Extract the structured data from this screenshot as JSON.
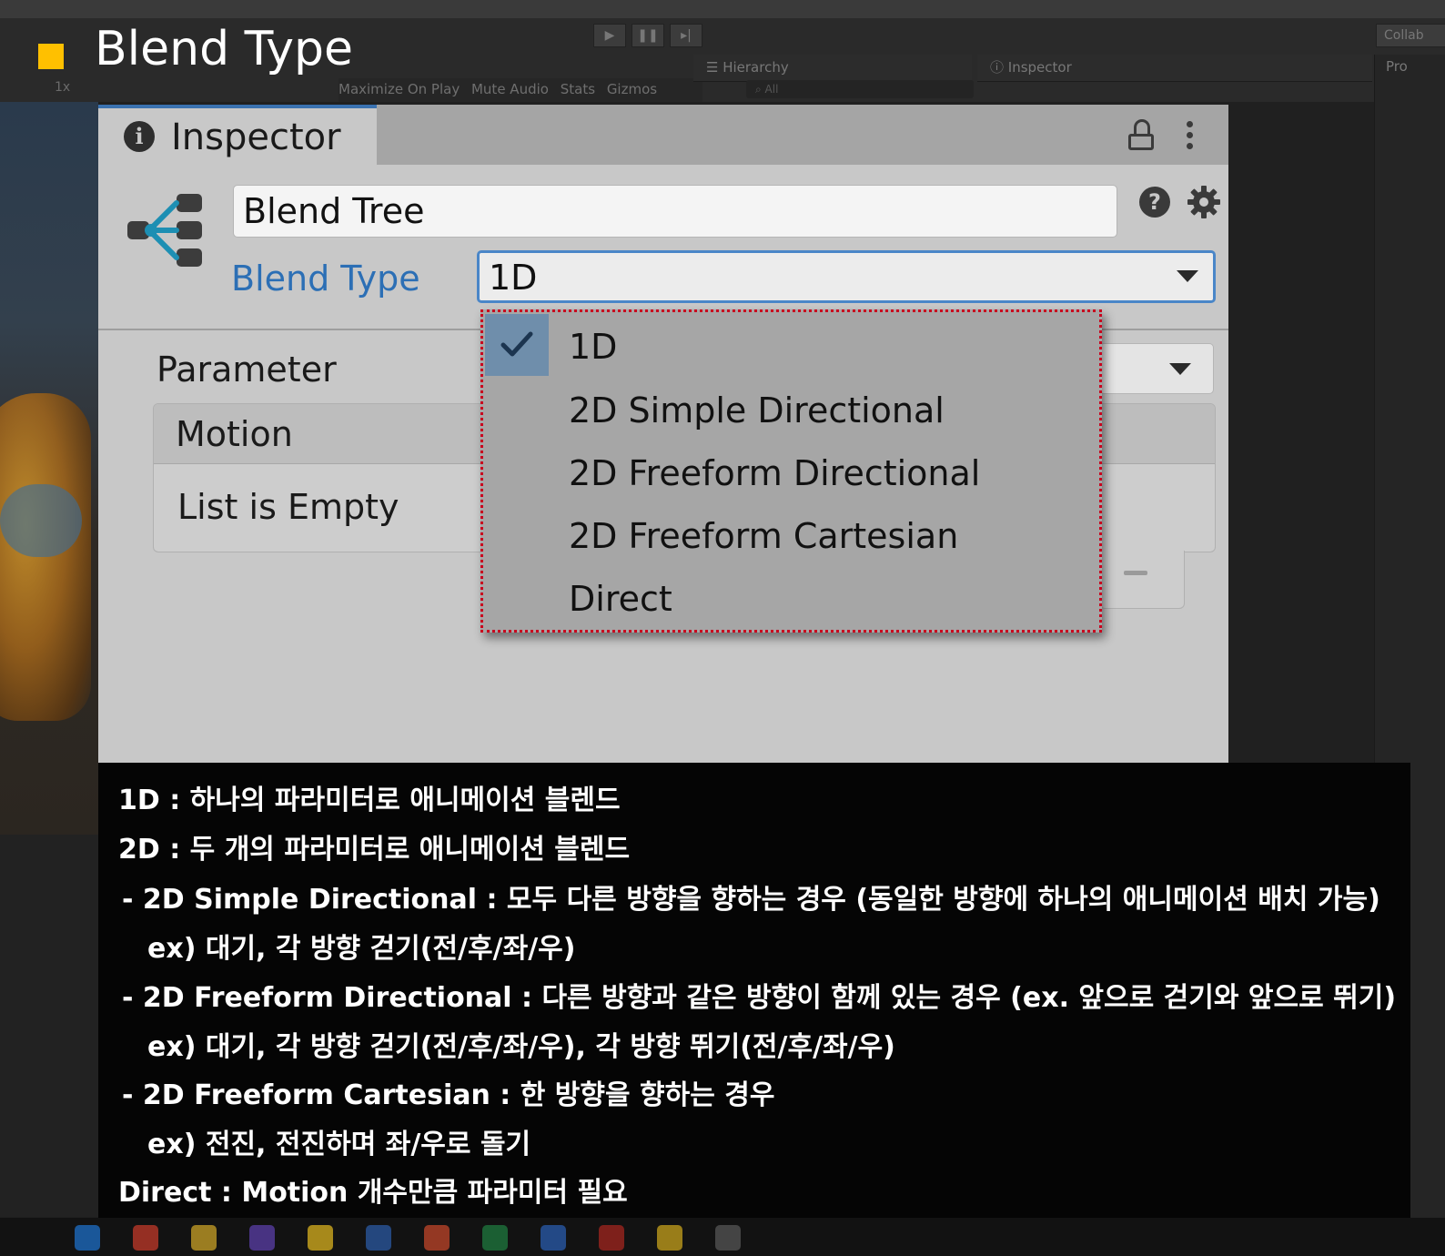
{
  "slide": {
    "title": "Blend Type",
    "accent": "#ffc000"
  },
  "editor_bg": {
    "scale_label": "1x",
    "game_toolbar": [
      "Maximize On Play",
      "Mute Audio",
      "Stats",
      "Gizmos"
    ],
    "hierarchy_tab": "Hierarchy",
    "hierarchy_search": "All",
    "inspector_tab_small": "Inspector",
    "collab_label": "Collab",
    "project_tab": "Pro"
  },
  "inspector": {
    "tab_label": "Inspector",
    "name_value": "Blend Tree",
    "blend_type_label": "Blend Type",
    "blend_type_value": "1D",
    "parameter_label": "Parameter",
    "motion_header": "Motion",
    "list_empty_text": "List is Empty",
    "accent": "#2c6fb5",
    "icons": [
      "info-icon",
      "lock-icon",
      "kebab-menu-icon",
      "blend-tree-icon",
      "help-icon",
      "gear-icon",
      "dropdown-caret-icon",
      "minus-icon"
    ]
  },
  "dropdown": {
    "selected": "1D",
    "options": [
      "1D",
      "2D Simple Directional",
      "2D Freeform Directional",
      "2D Freeform Cartesian",
      "Direct"
    ],
    "highlight_border": "#c8001e",
    "check_icon": "checkmark-icon"
  },
  "caption": {
    "lines": [
      "1D : 하나의 파라미터로 애니메이션 블렌드",
      "2D : 두 개의 파라미터로 애니메이션 블렌드",
      " - 2D Simple Directional : 모두 다른 방향을 향하는 경우 (동일한 방향에 하나의 애니메이션 배치 가능)",
      "ex) 대기, 각 방향 걷기(전/후/좌/우)",
      " - 2D Freeform Directional : 다른 방향과 같은 방향이 함께 있는 경우 (ex. 앞으로 걷기와 앞으로 뛰기)",
      "ex) 대기, 각 방향 걷기(전/후/좌/우), 각 방향 뛰기(전/후/좌/우)",
      " - 2D Freeform Cartesian : 한 방향을 향하는 경우",
      "ex) 전진, 전진하며 좌/우로 돌기",
      "Direct : Motion 개수만큼 파라미터 필요"
    ]
  }
}
